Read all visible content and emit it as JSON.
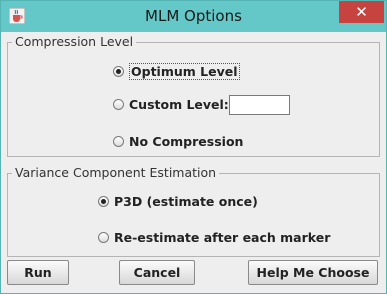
{
  "window": {
    "title": "MLM Options",
    "close_glyph": "✕",
    "app_icon": "java-cup-icon"
  },
  "compression": {
    "legend": "Compression Level",
    "options": [
      {
        "label": "Optimum Level",
        "checked": true
      },
      {
        "label": "Custom Level:",
        "checked": false
      },
      {
        "label": "No Compression",
        "checked": false
      }
    ],
    "custom_value": ""
  },
  "variance": {
    "legend": "Variance Component Estimation",
    "options": [
      {
        "label": "P3D (estimate once)",
        "checked": true
      },
      {
        "label": "Re-estimate after each marker",
        "checked": false
      }
    ]
  },
  "buttons": {
    "run": "Run",
    "cancel": "Cancel",
    "help": "Help Me Choose"
  }
}
